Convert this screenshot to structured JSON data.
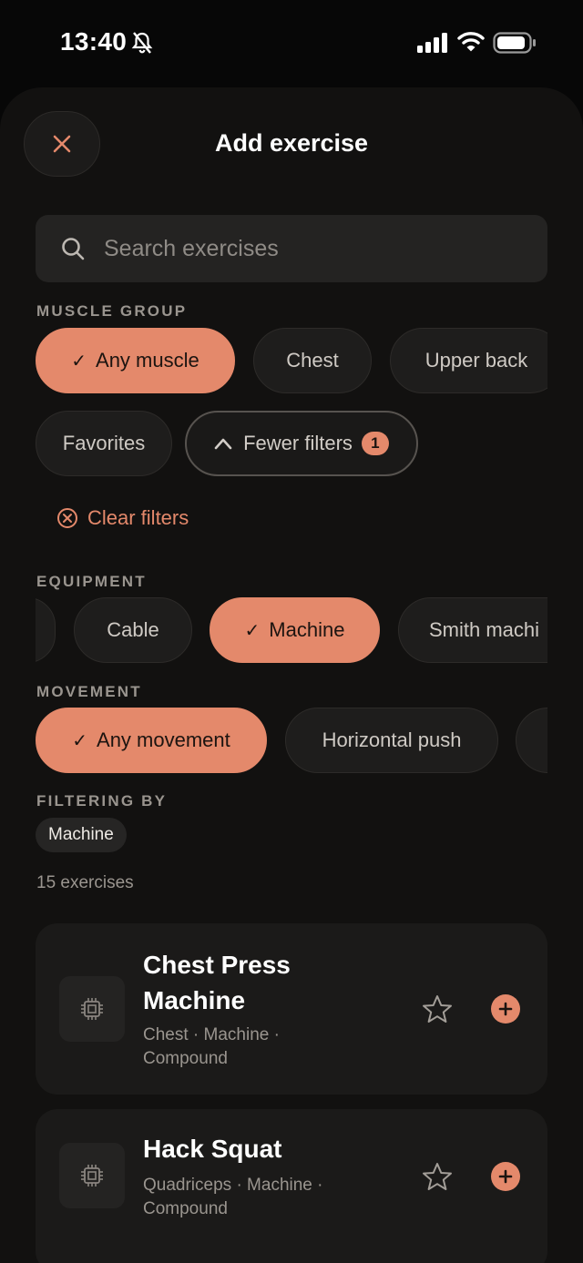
{
  "status_bar": {
    "time": "13:40"
  },
  "header": {
    "title": "Add exercise"
  },
  "search": {
    "placeholder": "Search exercises",
    "value": ""
  },
  "muscle_group": {
    "label": "MUSCLE GROUP",
    "chips": [
      "Any muscle",
      "Chest",
      "Upper back"
    ],
    "favorites": "Favorites",
    "fewer_filters": "Fewer filters",
    "filter_count": "1"
  },
  "clear_filters": "Clear filters",
  "equipment": {
    "label": "EQUIPMENT",
    "chips": [
      "Cable",
      "Machine",
      "Smith machi"
    ]
  },
  "movement": {
    "label": "MOVEMENT",
    "chips": [
      "Any movement",
      "Horizontal push"
    ]
  },
  "filtering_by": {
    "label": "FILTERING BY",
    "tags": [
      "Machine"
    ]
  },
  "results": {
    "count": "15 exercises"
  },
  "exercises": [
    {
      "name": "Chest Press Machine",
      "meta": "Chest · Machine · Compound",
      "icon": "cpu-icon"
    },
    {
      "name": "Hack Squat",
      "meta": "Quadriceps · Machine · Compound",
      "icon": "cpu-icon"
    }
  ],
  "colors": {
    "accent": "#e4896b",
    "sheet_bg": "#121110",
    "chip_bg": "#1e1d1c"
  }
}
